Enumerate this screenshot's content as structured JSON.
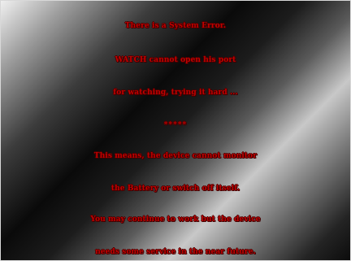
{
  "error_screen": {
    "lines": [
      "There is a System Error.",
      "WATCH cannot open his port",
      "for watching, trying it hard ...",
      "*****",
      "This means, the device cannot monitor",
      "the Battery or switch off itself.",
      "You may continue to work but the device",
      "needs some service in the near future."
    ]
  },
  "colors": {
    "text": "#c00000",
    "text_outline": "#4a0000"
  }
}
